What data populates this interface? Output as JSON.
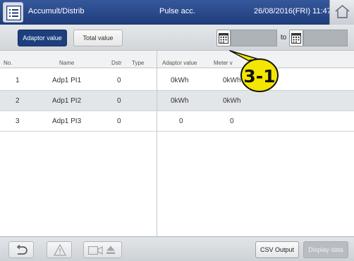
{
  "titlebar": {
    "screen_title": "Accumult/Distrib",
    "mode": "Pulse acc.",
    "datetime": "26/08/2016(FRI) 11:47"
  },
  "controls": {
    "adaptor_value_label": "Adaptor value",
    "total_value_label": "Total value",
    "from_date": "",
    "to_label": "to",
    "to_date": ""
  },
  "callout": {
    "label": "3-1"
  },
  "table": {
    "headers": {
      "no": "No.",
      "name": "Name",
      "dstr": "Dstr",
      "type": "Type",
      "adaptor_value": "Adaptor value",
      "meter_value": "Meter v"
    },
    "rows": [
      {
        "no": "1",
        "name": "Adp1 PI1",
        "dstr": "0",
        "type": "",
        "adaptor_value": "0kWh",
        "meter_value": "0kWh"
      },
      {
        "no": "2",
        "name": "Adp1 PI2",
        "dstr": "0",
        "type": "",
        "adaptor_value": "0kWh",
        "meter_value": "0kWh"
      },
      {
        "no": "3",
        "name": "Adp1 PI3",
        "dstr": "0",
        "type": "",
        "adaptor_value": "0",
        "meter_value": "0"
      }
    ]
  },
  "footer": {
    "csv_output_label": "CSV Output",
    "display_data_label": "Display data"
  },
  "colors": {
    "title_bar": "#1f3c7a",
    "selected_button": "#1e3f7e",
    "callout_fill": "#f3e600"
  },
  "icons": [
    "menu-list-icon",
    "home-icon",
    "calendar-icon",
    "back-arrow-icon",
    "warning-icon",
    "camera-icon",
    "eject-icon"
  ]
}
